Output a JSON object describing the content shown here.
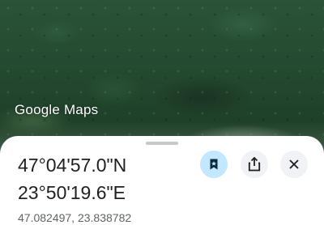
{
  "map": {
    "attribution": "Google Maps"
  },
  "place": {
    "latitude_dms": "47°04'57.0\"N",
    "longitude_dms": "23°50'19.6\"E",
    "decimal_coords": "47.082497, 23.838782"
  },
  "actions": {
    "save_icon": "bookmark-icon",
    "share_icon": "share-icon",
    "close_icon": "close-icon"
  },
  "colors": {
    "save_button_bg": "#c2e7ff",
    "icon_button_bg": "#f0f2f5",
    "text_primary": "#1f1f1f",
    "text_secondary": "#5f6368"
  }
}
